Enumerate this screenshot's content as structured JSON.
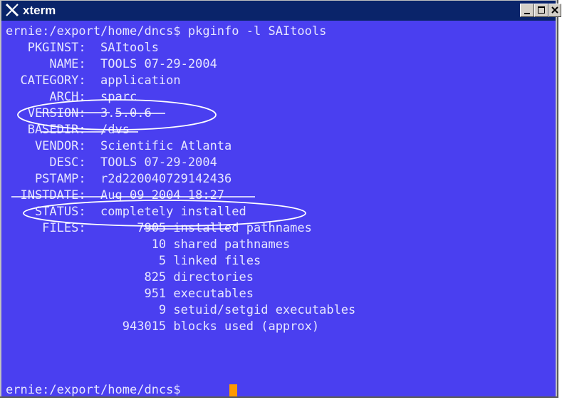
{
  "window": {
    "title": "xterm",
    "buttons": [
      "minimize",
      "maximize",
      "close"
    ]
  },
  "terminal": {
    "lines": [
      "ernie:/export/home/dncs$ pkginfo -l SAItools",
      "   PKGINST:  SAItools",
      "      NAME:  TOOLS 07-29-2004",
      "  CATEGORY:  application",
      "      ARCH:  sparc",
      "   VERSION:  3.5.0.6",
      "   BASEDIR:  /dvs",
      "    VENDOR:  Scientific Atlanta",
      "      DESC:  TOOLS 07-29-2004",
      "    PSTAMP:  r2d220040729142436",
      "  INSTDATE:  Aug 09 2004 18:27",
      "    STATUS:  completely installed",
      "     FILES:       7905 installed pathnames",
      "                    10 shared pathnames",
      "                     5 linked files",
      "                   825 directories",
      "                   951 executables",
      "                     9 setuid/setgid executables",
      "                943015 blocks used (approx)",
      "",
      "ernie:/export/home/dncs$ "
    ]
  },
  "colors": {
    "titlebar": "#0a246a",
    "terminal_bg": "#4a3ff0",
    "terminal_fg": "#e6e6ff",
    "cursor": "#ff9900",
    "annotation": "#ffffff"
  },
  "icons": {
    "app": "x-logo-icon",
    "minimize": "minimize-icon",
    "maximize": "maximize-icon",
    "close": "close-icon"
  }
}
